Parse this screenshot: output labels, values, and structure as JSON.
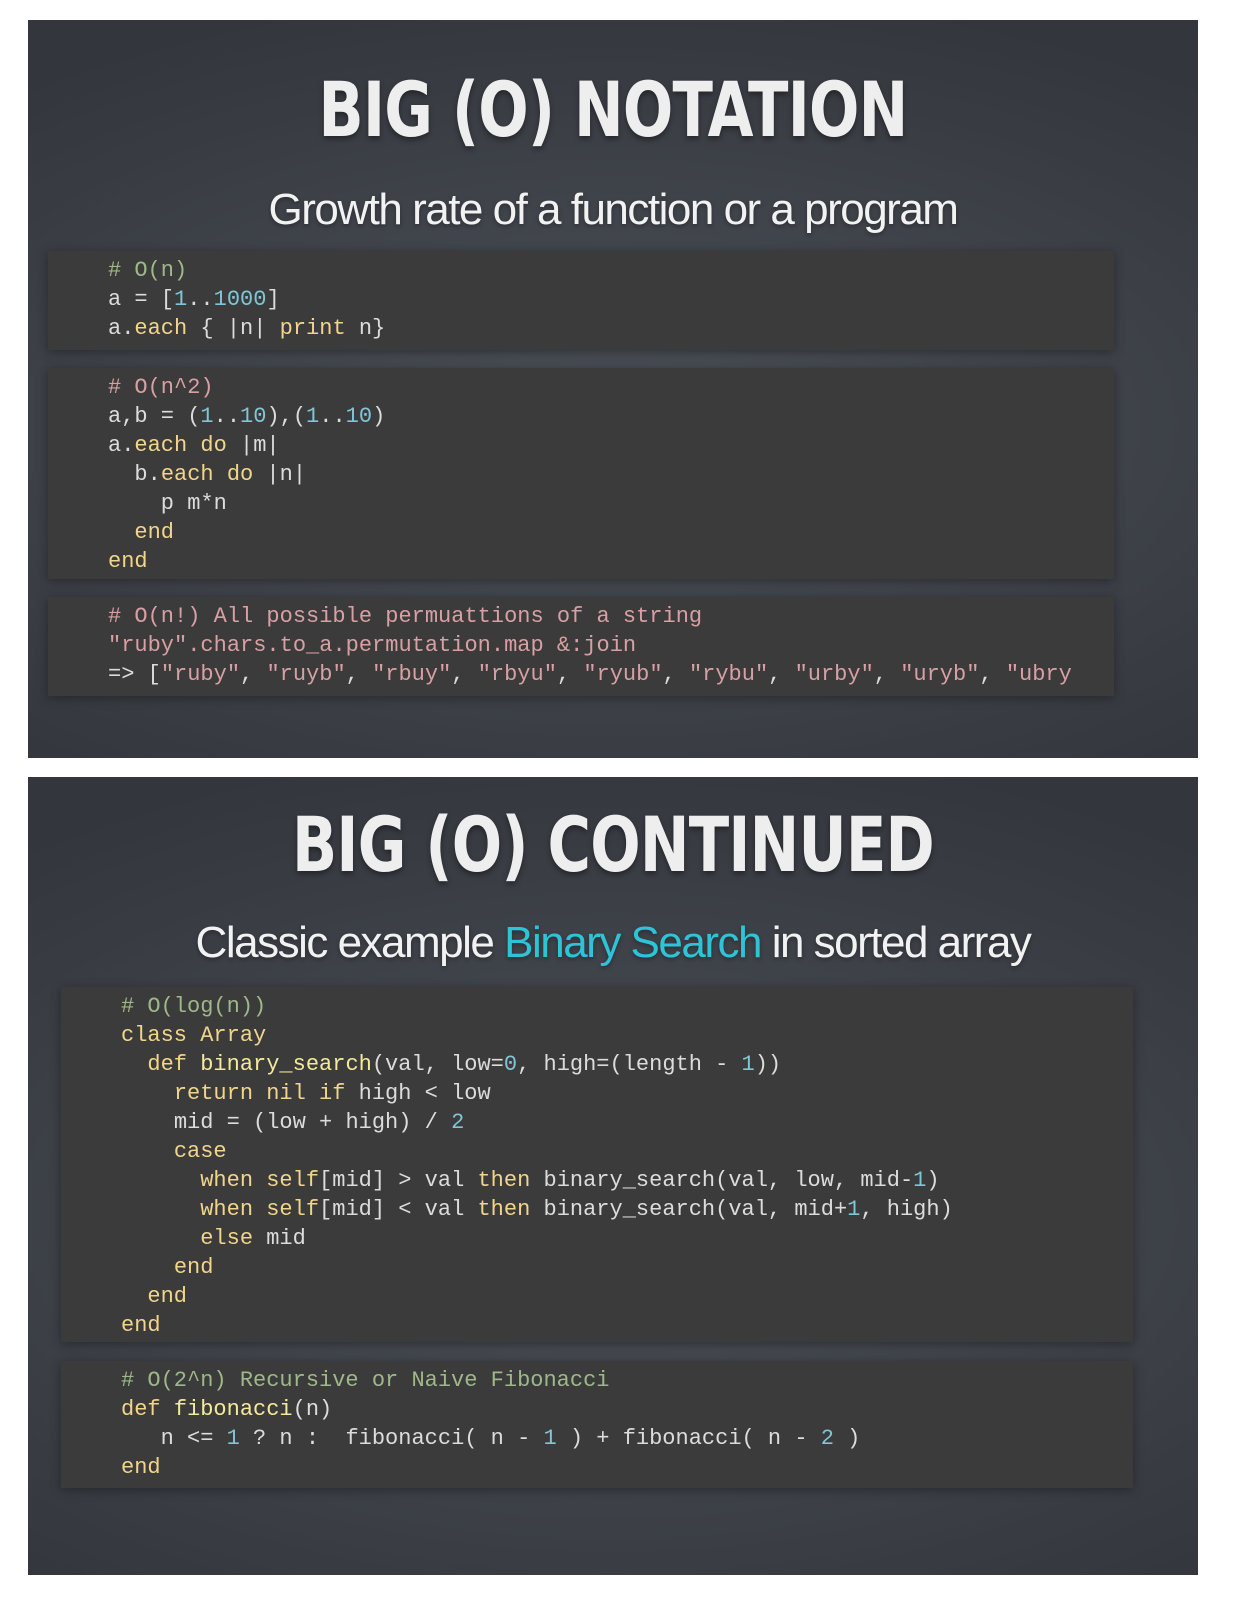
{
  "slide1": {
    "title": "BIG (O) NOTATION",
    "subtitle": "Growth rate of a function or a program",
    "block1": {
      "comment": "# O(n)",
      "l2a": "a = [",
      "l2n1": "1",
      "l2b": "..",
      "l2n2": "1000",
      "l2c": "]",
      "l3a": "a.",
      "l3each": "each",
      "l3b": " { |n| ",
      "l3print": "print",
      "l3c": " n}"
    },
    "block2": {
      "comment": "# O(n^2)",
      "l2a": "a,b = (",
      "l2n1": "1",
      "l2b": "..",
      "l2n2": "10",
      "l2c": "),(",
      "l2n3": "1",
      "l2d": "..",
      "l2n4": "10",
      "l2e": ")",
      "l3a": "a.",
      "l3each": "each",
      "l3do": "do",
      "l3b": " |m|",
      "l4a": "  b.",
      "l4each": "each",
      "l4do": "do",
      "l4b": " |n|",
      "l5": "    p m*n",
      "l6": "end",
      "l7": "end"
    },
    "block3": {
      "comment": "# O(n!) All possible permuattions of a string",
      "l2str": "\"ruby\"",
      "l2a": ".chars.to_a.permutation.map &:join",
      "l3a": "=> [",
      "l3items": [
        "\"ruby\"",
        "\"ruyb\"",
        "\"rbuy\"",
        "\"rbyu\"",
        "\"ryub\"",
        "\"rybu\"",
        "\"urby\"",
        "\"uryb\"",
        "\"ubry"
      ]
    }
  },
  "slide2": {
    "title": "BIG (O) CONTINUED",
    "subtitle_a": "Classic example ",
    "subtitle_b": "Binary Search",
    "subtitle_c": " in sorted array",
    "block1": {
      "comment": "# O(log(n))",
      "l2class": "class",
      "l2name": "Array",
      "l3def": "def",
      "l3fn": "binary_search",
      "l3a": "(val, low=",
      "l3n0": "0",
      "l3b": ", high=(length - ",
      "l3n1": "1",
      "l3c": "))",
      "l4return": "return",
      "l4nil": "nil",
      "l4if": "if",
      "l4a": " high < low",
      "l5a": "mid = (low + high) / ",
      "l5n": "2",
      "l6": "case",
      "l7when": "when",
      "l7self": "self",
      "l7a": "[mid] > val ",
      "l7then": "then",
      "l7b": " binary_search(val, low, mid-",
      "l7n": "1",
      "l7c": ")",
      "l8when": "when",
      "l8self": "self",
      "l8a": "[mid] < val ",
      "l8then": "then",
      "l8b": " binary_search(val, mid+",
      "l8n": "1",
      "l8c": ", high)",
      "l9else": "else",
      "l9a": " mid",
      "l10": "end",
      "l11": "end",
      "l12": "end"
    },
    "block2": {
      "comment": "# O(2^n) Recursive or Naive Fibonacci",
      "l2def": "def",
      "l2fn": "fibonacci",
      "l2a": "(n)",
      "l3a": "   n <= ",
      "l3n1": "1",
      "l3b": " ? n : ",
      "l3c": " fibonacci( n - ",
      "l3n2": "1",
      "l3d": " ) + fibonacci( n - ",
      "l3n3": "2",
      "l3e": " )",
      "l4": "end"
    }
  },
  "colors": {
    "code_keyword": "#f1d58a",
    "code_number": "#7fc6d6",
    "code_string": "#d8a0a4",
    "code_comment_green": "#9fb88a",
    "subtitle_highlight": "#2fc3d8",
    "code_background": "#3b3b3b"
  }
}
